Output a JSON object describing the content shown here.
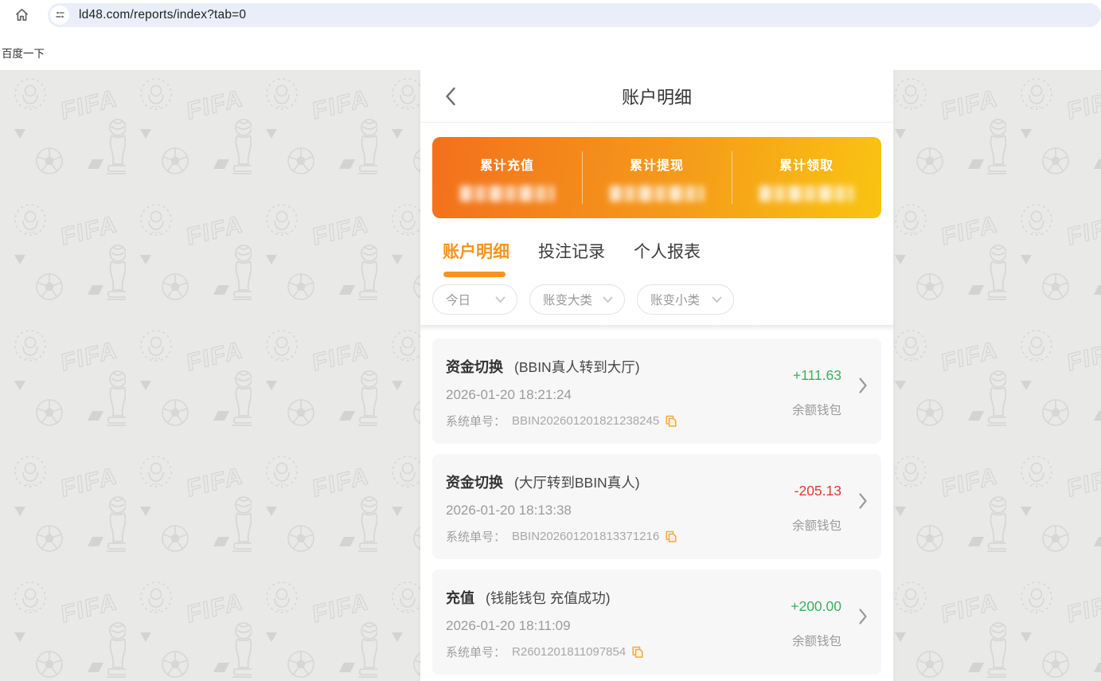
{
  "browser": {
    "url": "ld48.com/reports/index?tab=0",
    "icons": {
      "home": "home",
      "url_left": "tune-site-settings"
    }
  },
  "bookmarks": {
    "baidu_label": "百度一下"
  },
  "page": {
    "header": {
      "title": "账户明细",
      "back_icon": "chevron-left"
    },
    "stats": {
      "items": [
        {
          "label": "累计充值",
          "value_redacted": true
        },
        {
          "label": "累计提现",
          "value_redacted": true
        },
        {
          "label": "累计领取",
          "value_redacted": true
        }
      ]
    },
    "tabs": [
      {
        "label": "账户明细",
        "active": true
      },
      {
        "label": "投注记录",
        "active": false
      },
      {
        "label": "个人报表",
        "active": false
      }
    ],
    "filters": [
      {
        "label": "今日"
      },
      {
        "label": "账变大类"
      },
      {
        "label": "账变小类"
      }
    ],
    "list": {
      "order_label": "系统单号：",
      "items": [
        {
          "type": "资金切换",
          "subtitle": "(BBIN真人转到大厅)",
          "datetime": "2026-01-20 18:21:24",
          "order_no": "BBIN202601201821238245",
          "amount": "+111.63",
          "amount_color": "#3cb15a",
          "wallet": "余额钱包"
        },
        {
          "type": "资金切换",
          "subtitle": "(大厅转到BBIN真人)",
          "datetime": "2026-01-20 18:13:38",
          "order_no": "BBIN202601201813371216",
          "amount": "-205.13",
          "amount_color": "#e23a2e",
          "wallet": "余额钱包"
        },
        {
          "type": "充值",
          "subtitle": "(钱能钱包 充值成功)",
          "datetime": "2026-01-20 18:11:09",
          "order_no": "R2601201811097854",
          "amount": "+200.00",
          "amount_color": "#3cb15a",
          "wallet": "余额钱包"
        }
      ]
    },
    "colors": {
      "accent_orange": "#f7941e",
      "gradient_start": "#f3701d",
      "gradient_end": "#f9c411",
      "positive": "#3cb15a",
      "negative": "#e23a2e"
    }
  }
}
